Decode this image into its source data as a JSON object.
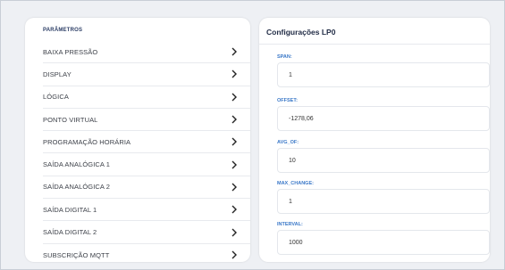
{
  "parametros": {
    "title": "PARÂMETROS",
    "items": [
      {
        "label": "BAIXA PRESSÃO"
      },
      {
        "label": "DISPLAY"
      },
      {
        "label": "LÓGICA"
      },
      {
        "label": "PONTO VIRTUAL"
      },
      {
        "label": "PROGRAMAÇÃO HORÁRIA"
      },
      {
        "label": "SAÍDA ANALÓGICA 1"
      },
      {
        "label": "SAÍDA ANALÓGICA 2"
      },
      {
        "label": "SAÍDA DIGITAL 1"
      },
      {
        "label": "SAÍDA DIGITAL 2"
      },
      {
        "label": "SUBSCRIÇÃO MQTT"
      }
    ],
    "chevron_icon": "chevron-right-icon"
  },
  "config": {
    "title": "Configurações LP0",
    "fields": [
      {
        "label": "SPAN:",
        "value": "1"
      },
      {
        "label": "OFFSET:",
        "value": "-1278,06"
      },
      {
        "label": "AVG_OF:",
        "value": "10"
      },
      {
        "label": "MAX_CHANGE:",
        "value": "1"
      },
      {
        "label": "INTERVAL:",
        "value": "1000"
      }
    ]
  },
  "colors": {
    "background": "#eef0f4",
    "panel": "#ffffff",
    "field_label": "#3a78c8",
    "title": "#1f2a44"
  }
}
